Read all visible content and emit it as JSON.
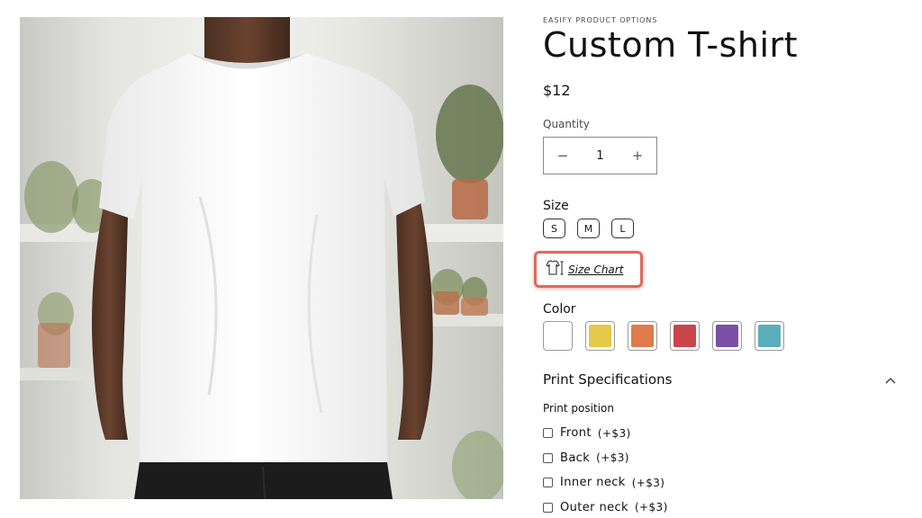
{
  "product": {
    "vendor": "EASIFY PRODUCT OPTIONS",
    "title": "Custom T-shirt",
    "price": "$12"
  },
  "quantity": {
    "label": "Quantity",
    "value": "1",
    "decrease_symbol": "−",
    "increase_symbol": "+"
  },
  "size": {
    "label": "Size",
    "options": [
      "S",
      "M",
      "L"
    ],
    "chart_link": "Size Chart"
  },
  "color": {
    "label": "Color",
    "swatches": [
      "#ffffff",
      "#e6c84a",
      "#e07b4c",
      "#c9454b",
      "#7b4fa6",
      "#5aaebc"
    ]
  },
  "print_specifications": {
    "title": "Print Specifications",
    "expanded": true,
    "position_label": "Print position",
    "options": [
      {
        "name": "Front",
        "price": "(+$3)"
      },
      {
        "name": "Back",
        "price": "(+$3)"
      },
      {
        "name": "Inner neck",
        "price": "(+$3)"
      },
      {
        "name": "Outer neck",
        "price": "(+$3)"
      }
    ]
  },
  "colors": {
    "highlight": "#e0685d",
    "text": "#121212",
    "border": "#8a8a8a"
  },
  "icons": {
    "size_chart": "tshirt-ruler-icon",
    "collapse": "chevron-up-icon"
  }
}
